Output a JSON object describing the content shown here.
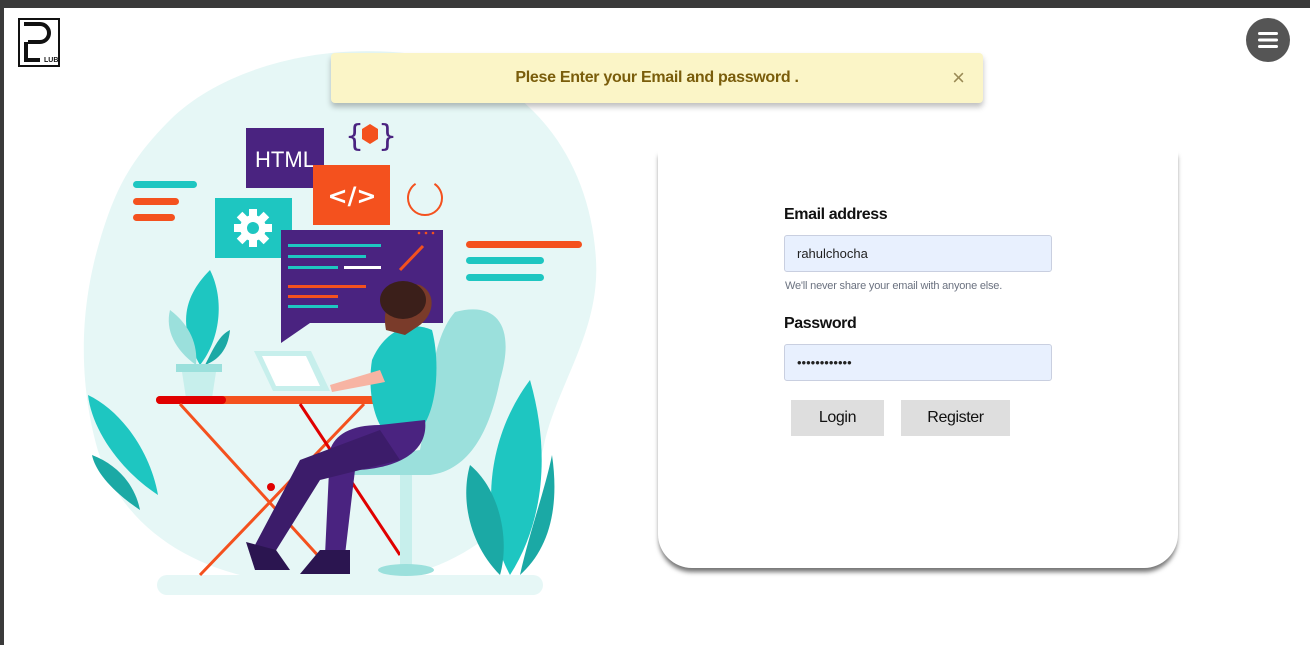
{
  "brand": {
    "logo_letter": "P",
    "logo_text": "LUB"
  },
  "alert": {
    "message": "Plese Enter your Email and password .",
    "close_label": "×"
  },
  "illustration": {
    "html_tag": "HTML",
    "code_tag": "</>",
    "braces": "{ }"
  },
  "form": {
    "email_label": "Email address",
    "email_value": "rahulchocha",
    "email_hint": "We'll never share your email with anyone else.",
    "password_label": "Password",
    "password_value": "rahulchocha1",
    "login_label": "Login",
    "register_label": "Register"
  },
  "colors": {
    "teal": "#1ec6c1",
    "orange": "#f4511e",
    "purple": "#4a2380",
    "alert_bg": "#fbf5c7",
    "alert_text": "#7a5d0b",
    "input_bg": "#e8f0fe"
  },
  "icons": {
    "menu": "hamburger-icon",
    "gear": "gear-icon",
    "refresh": "refresh-icon"
  }
}
